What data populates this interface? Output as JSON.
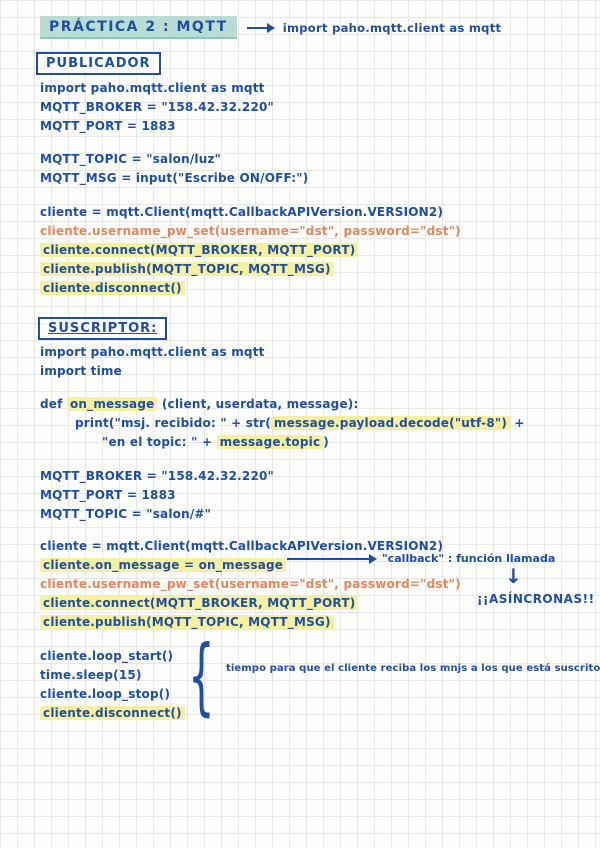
{
  "title": {
    "text": "PRÁCTICA 2 : MQTT",
    "note": "import paho.mqtt.client as mqtt"
  },
  "publicador": {
    "heading": "PUBLICADOR",
    "group1": [
      "import paho.mqtt.client as mqtt",
      "MQTT_BROKER = \"158.42.32.220\"",
      "MQTT_PORT = 1883"
    ],
    "group2": [
      "MQTT_TOPIC = \"salon/luz\"",
      "MQTT_MSG = input(\"Escribe ON/OFF:\")"
    ],
    "client": "cliente = mqtt.Client(mqtt.CallbackAPIVersion.VERSION2)",
    "auth": "cliente.username_pw_set(username=\"dst\", password=\"dst\")",
    "connect": "cliente.connect(MQTT_BROKER, MQTT_PORT)",
    "publish": "cliente.publish(MQTT_TOPIC, MQTT_MSG)",
    "disconnect": "cliente.disconnect()"
  },
  "suscriptor": {
    "heading": "SUSCRIPTOR:",
    "imports": [
      "import  paho.mqtt.client as mqtt",
      "import  time"
    ],
    "def_line": {
      "pre": "def ",
      "hl": "on_message",
      "post": " (client, userdata, message):"
    },
    "print1": {
      "pre": "print(\"msj. recibido: \" + str(",
      "hl": "message.payload.decode(\"utf-8\")",
      "post": " +"
    },
    "print2": {
      "pre": "\"en el topic: \" + ",
      "hl": "message.topic",
      "post": ")"
    },
    "config": [
      "MQTT_BROKER = \"158.42.32.220\"",
      "MQTT_PORT = 1883",
      "MQTT_TOPIC = \"salon/#\""
    ],
    "client": "cliente = mqtt.Client(mqtt.CallbackAPIVersion.VERSION2)",
    "on_message_assign": "cliente.on_message = on_message",
    "callback_note": "\"callback\" : función llamada",
    "auth": "cliente.username_pw_set(username=\"dst\", password=\"dst\")",
    "connect": "cliente.connect(MQTT_BROKER, MQTT_PORT)",
    "publish": "cliente.publish(MQTT_TOPIC, MQTT_MSG)",
    "asincronas_note": "¡¡ASÍNCRONAS!!",
    "loop": [
      "cliente.loop_start()",
      "time.sleep(15)",
      "cliente.loop_stop()",
      "cliente.disconnect()"
    ],
    "loop_note": "tiempo para que el cliente reciba los mnjs a los que está suscrito"
  },
  "colors": {
    "ink_blue": "#1e4fa3",
    "ink_orange": "#e8855c",
    "highlight_yellow": "#f6f0a0",
    "highlight_teal": "#b9ddd4",
    "grid_line": "#e8e8e8"
  }
}
